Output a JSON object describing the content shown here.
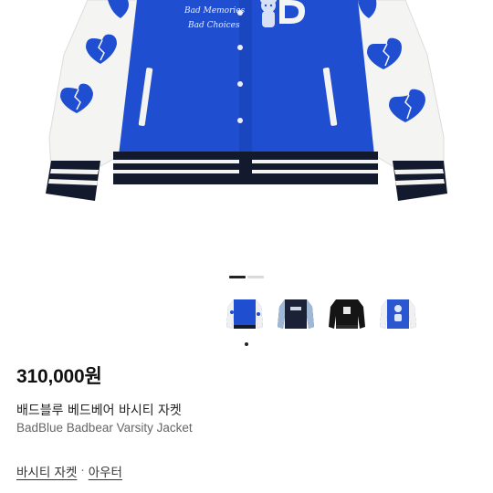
{
  "hero": {
    "image_name": "blue-varsity-jacket-photo",
    "colors": {
      "body": "#1f4fd0",
      "sleeve": "#f4f4f2",
      "rib_dark": "#141a2e",
      "heart": "#1f4fd0"
    }
  },
  "carousel": {
    "total_pages": 2,
    "current_page": 1
  },
  "variants": [
    {
      "name": "blue-white",
      "body": "#1f4fd0",
      "sleeve": "#f0f0f0",
      "selected": true
    },
    {
      "name": "navy-denim",
      "body": "#1b2238",
      "sleeve": "#9fb8d8",
      "selected": false
    },
    {
      "name": "black",
      "body": "#151515",
      "sleeve": "#151515",
      "selected": false
    },
    {
      "name": "blue-bear",
      "body": "#2a56cf",
      "sleeve": "#f0f0f0",
      "selected": false
    }
  ],
  "product": {
    "price": "310,000원",
    "title_ko": "배드블루 베드베어 바시티 자켓",
    "title_en": "BadBlue Badbear Varsity Jacket",
    "category_main": "바시티 자켓",
    "category_separator": "·",
    "category_sub": "아우터"
  },
  "hero_text": {
    "line1": "Bad Memories",
    "line2": "Bad Choices"
  }
}
